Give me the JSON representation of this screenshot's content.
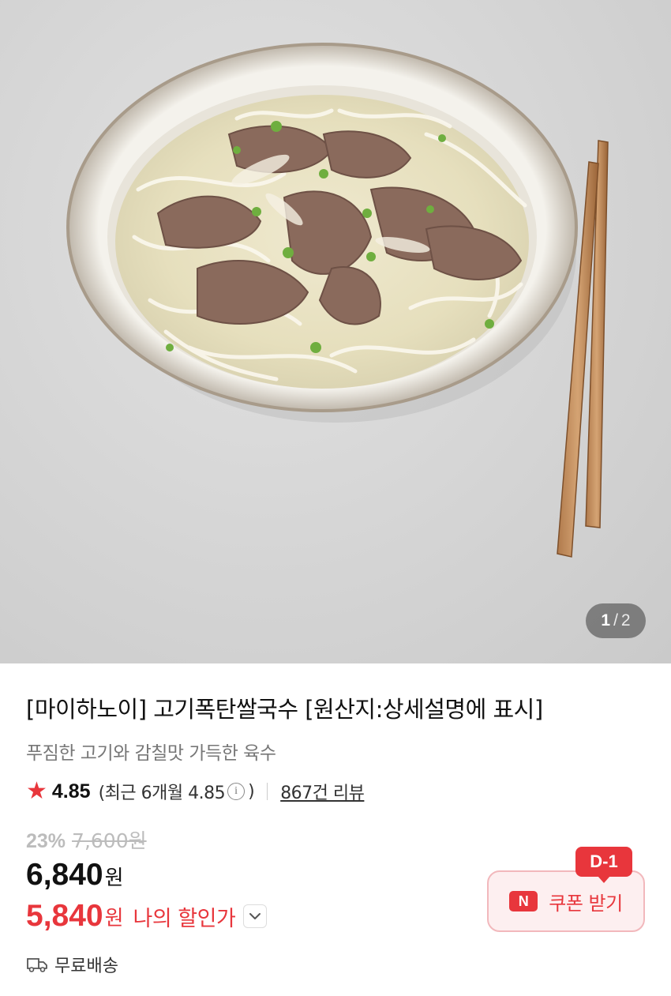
{
  "gallery": {
    "image_alt": "bowl of beef rice noodle soup with chopsticks",
    "current_index": "1",
    "separator": "/",
    "total": "2"
  },
  "product": {
    "title": "[마이하노이] 고기폭탄쌀국수 [원산지:상세설명에 표시]",
    "subtitle": "푸짐한 고기와 감칠맛 가득한 육수"
  },
  "rating": {
    "star_icon": "star-icon",
    "score": "4.85",
    "recent_prefix": "(최근 6개월 4.85",
    "info_icon": "info-icon",
    "recent_suffix": ")",
    "reviews_link": "867건 리뷰"
  },
  "pricing": {
    "discount_rate": "23%",
    "original_price": "7,600원",
    "sale_price": "6,840",
    "sale_unit": "원",
    "my_price": "5,840",
    "my_unit": "원",
    "my_price_label": "나의 할인가",
    "accent_color": "#e8363c"
  },
  "shipping": {
    "truck_icon": "truck-icon",
    "label": "무료배송"
  },
  "coupon": {
    "dday": "D-1",
    "badge": "N",
    "label": "쿠폰 받기"
  }
}
